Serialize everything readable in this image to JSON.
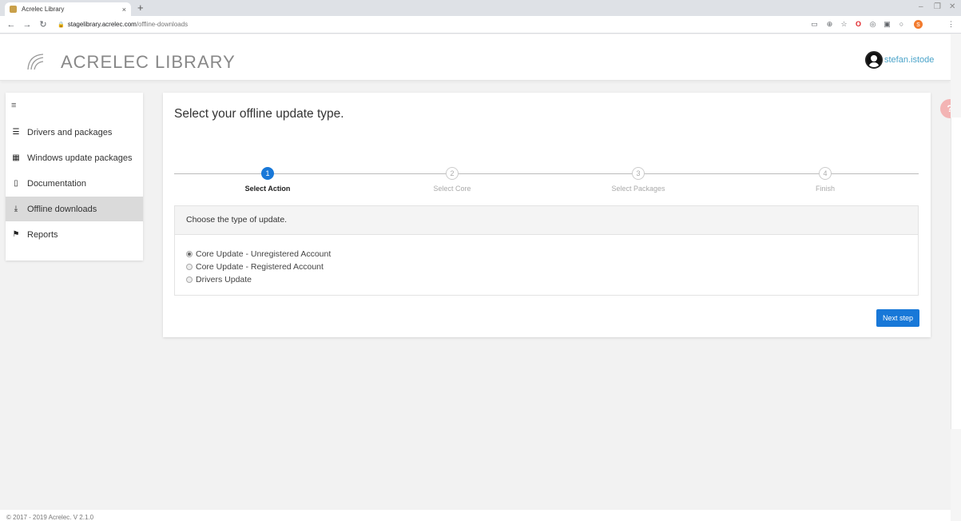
{
  "browser": {
    "tab_title": "Acrelec Library",
    "tab_close": "×",
    "new_tab": "+",
    "url_host": "stagelibrary.acrelec.com",
    "url_path": "/offline-downloads"
  },
  "header": {
    "brand": "ACRELEC LIBRARY",
    "username": "stefan.istode"
  },
  "sidebar": {
    "items": [
      {
        "label": "Drivers and packages",
        "icon": "list-icon"
      },
      {
        "label": "Windows update packages",
        "icon": "windows-icon"
      },
      {
        "label": "Documentation",
        "icon": "document-icon"
      },
      {
        "label": "Offline downloads",
        "icon": "download-icon",
        "active": true
      },
      {
        "label": "Reports",
        "icon": "flag-icon"
      }
    ]
  },
  "main": {
    "title": "Select your offline update type.",
    "steps": [
      {
        "number": "1",
        "label": "Select Action",
        "active": true
      },
      {
        "number": "2",
        "label": "Select Core"
      },
      {
        "number": "3",
        "label": "Select Packages"
      },
      {
        "number": "4",
        "label": "Finish"
      }
    ],
    "panel_heading": "Choose the type of update.",
    "options": [
      {
        "label": "Core Update - Unregistered Account",
        "checked": true
      },
      {
        "label": "Core Update - Registered Account"
      },
      {
        "label": "Drivers Update"
      }
    ],
    "next_button": "Next step"
  },
  "help": {
    "label": "?"
  },
  "footer": {
    "text": "© 2017 - 2019 Acrelec. V 2.1.0"
  },
  "colors": {
    "accent": "#1878d8",
    "link": "#4aa3c9",
    "help": "#f3b4b4"
  }
}
